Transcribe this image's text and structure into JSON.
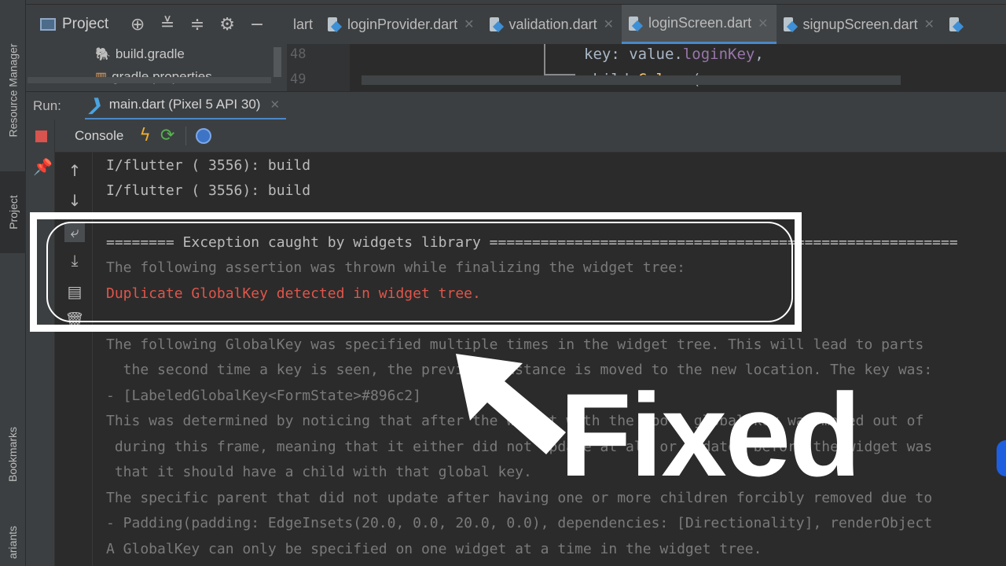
{
  "left_strip": {
    "resource_manager": "Resource Manager",
    "project": "Project",
    "bookmarks": "Bookmarks",
    "build_variants": "ariants"
  },
  "project_toolbar": {
    "title": "Project"
  },
  "editor_tabs": [
    {
      "label": "lart",
      "active": false
    },
    {
      "label": "loginProvider.dart",
      "active": false
    },
    {
      "label": "validation.dart",
      "active": false
    },
    {
      "label": "loginScreen.dart",
      "active": true
    },
    {
      "label": "signupScreen.dart",
      "active": false
    }
  ],
  "tree": {
    "items": [
      "build.gradle",
      "gradle.properties"
    ]
  },
  "code": {
    "line_numbers": [
      "48",
      "49"
    ],
    "line1_key": "key: ",
    "line1_value": "value.",
    "line1_prop": "loginKey",
    "line1_end": ",",
    "line2_child": "child:",
    "line2_fn": "Column",
    "line2_paren": "("
  },
  "run": {
    "label": "Run:",
    "tab_label": "main.dart (Pixel 5 API 30)"
  },
  "console": {
    "tab_label": "Console",
    "lines": [
      {
        "text": "I/flutter ( 3556): build",
        "style": "normal"
      },
      {
        "text": "I/flutter ( 3556): build",
        "style": "normal"
      },
      {
        "text": "======== Exception caught by widgets library =======================================================",
        "style": "normal"
      },
      {
        "text": "The following assertion was thrown while finalizing the widget tree:",
        "style": "dim"
      },
      {
        "text": "Duplicate GlobalKey detected in widget tree.",
        "style": "err"
      },
      {
        "text": "The following GlobalKey was specified multiple times in the widget tree. This will lead to parts",
        "style": "dim"
      },
      {
        "text": "  the second time a key is seen, the previous instance is moved to the new location. The key was:",
        "style": "dim"
      },
      {
        "text": "- [LabeledGlobalKey<FormState>#896c2]",
        "style": "dim"
      },
      {
        "text": "This was determined by noticing that after the widget with the above global key was moved out of",
        "style": "dim"
      },
      {
        "text": " during this frame, meaning that it either did not update at all or updated before the widget was",
        "style": "dim"
      },
      {
        "text": " that it should have a child with that global key.",
        "style": "dim"
      },
      {
        "text": "The specific parent that did not update after having one or more children forcibly removed due to",
        "style": "dim"
      },
      {
        "text": "- Padding(padding: EdgeInsets(20.0, 0.0, 20.0, 0.0), dependencies: [Directionality], renderObject",
        "style": "dim"
      },
      {
        "text": "A GlobalKey can only be specified on one widget at a time in the widget tree.",
        "style": "dim"
      }
    ]
  },
  "overlay": {
    "fixed_label": "Fixed"
  }
}
